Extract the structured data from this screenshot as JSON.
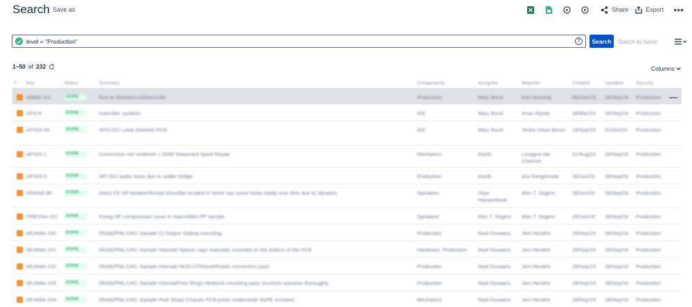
{
  "header": {
    "title": "Search",
    "save_as": "Save as",
    "share": "Share",
    "export": "Export",
    "more": "•••",
    "icons": [
      "excel-icon",
      "sheet-icon",
      "rss-icon",
      "rss-comments-icon",
      "share-icon",
      "export-icon"
    ]
  },
  "search": {
    "jql": "level = \"Production\"",
    "help": "?",
    "button": "Search",
    "switch_basic": "Switch to basic"
  },
  "results": {
    "range": "1–50",
    "of": "of",
    "total": "232",
    "columns_label": "Columns"
  },
  "colors": {
    "primary": "#0052cc",
    "success": "#36b37e",
    "issue_type": "#f79233",
    "selected_row": "#dfe1e6"
  },
  "table": {
    "headers": [
      "T",
      "Key",
      "Status",
      "Summary",
      "Components",
      "Assignee",
      "Reporter",
      "Created",
      "Updated",
      "Security"
    ],
    "rows": [
      {
        "key": "AMBA-101",
        "status": "DONE",
        "summary": "Run-in Statistics+Inline/Invite",
        "component": "Production",
        "assignee": "Mary Bond",
        "reporter": "Kim Henning",
        "created": "08/Dec/23",
        "updated": "28/Sep/24",
        "security": "Production"
      },
      {
        "key": "APS-9",
        "status": "DONE",
        "summary": "Kalender: position",
        "component": "IOC",
        "assignee": "Mary Bond",
        "reporter": "Arian Rijneb",
        "created": "28/Mar/24",
        "updated": "28/Sep/24",
        "security": "Production"
      },
      {
        "key": "APSOI-45",
        "status": "DONE",
        "summary": "APS-DCI Lokal (Market) PCB",
        "component": "IOC",
        "assignee": "Mary Bond",
        "reporter": "Torlee Ortoe Bento",
        "created": "18/Sep/24",
        "updated": "01/Oct/24",
        "security": "Production"
      },
      {
        "key": "APSOI-1",
        "status": "DONE",
        "summary": "Connection not centered + DOM Seasoned Spool Repair",
        "component": "Mechanics",
        "assignee": "Kanth",
        "reporter": "Lesagne oto Chennel",
        "created": "01/Aug/24",
        "updated": "28/Sep/24",
        "security": "Production"
      },
      {
        "key": "APSOI-5",
        "status": "DONE",
        "summary": "API DCI audio issue due to solder bridge",
        "component": "Production",
        "assignee": "Kanth",
        "reporter": "Ara Rangehoste",
        "created": "26/Jun/24",
        "updated": "28/Sep/24",
        "security": "Production"
      },
      {
        "key": "HOKKE-80",
        "status": "DONE",
        "summary": "(Hon) FS HP breaker/thread shout/ller located in home can come loose easily over time due to vibration.",
        "component": "Speakers",
        "assignee": "Skye Hansenbook",
        "reporter": "Mon T. Segers",
        "created": "28/Jun/24",
        "updated": "28/Sep/24",
        "security": "Production"
      },
      {
        "key": "PRESSA-101",
        "status": "DONE",
        "summary": "Fixing HF compression issue in macro/Mini-PP sample",
        "component": "Speakers",
        "assignee": "Mon T. Segers",
        "reporter": "Mon T. Segers",
        "created": "28/Jun/24",
        "updated": "28/Sep/24",
        "security": "Production"
      },
      {
        "key": "MUAMA-100",
        "status": "DONE",
        "summary": "(RoM)/PML/UKC Sample C) Output Setting mounting",
        "component": "Production",
        "assignee": "Noel Duvaans",
        "reporter": "Joni Hendrix",
        "created": "28/Sep/24",
        "updated": "28/Sep/24",
        "security": "Production"
      },
      {
        "key": "MUAMA-101",
        "status": "DONE",
        "summary": "(RoM)/PML/UKC Sample Internal) Spacer caps manually mounted on the bottom of the PCB",
        "component": "Hardware, Production",
        "assignee": "Noel Duvaans",
        "reporter": "Joni Hendrix",
        "created": "28/Sep/24",
        "updated": "28/Sep/24",
        "security": "Production"
      },
      {
        "key": "MUAMA-102",
        "status": "DONE",
        "summary": "(RoM)/PML/UKC Sample Internal) NCE+UTRAnet/Praxis connectors pass",
        "component": "Production",
        "assignee": "Noel Duvaans",
        "reporter": "Joni Hendrix",
        "created": "28/Sep/24",
        "updated": "28/Sep/24",
        "security": "Production"
      },
      {
        "key": "MUAMA-103",
        "status": "DONE",
        "summary": "(RoM)/PML/UKC Sample Internal/Post Shop) Heatsink mounting pass structure outcome thoroughly",
        "component": "Production",
        "assignee": "Noel Duvaans",
        "reporter": "Joni Hendrix",
        "created": "28/Sep/24",
        "updated": "28/Sep/24",
        "security": "Production"
      },
      {
        "key": "MUAMA-104",
        "status": "DONE",
        "summary": "(RoM)/PML/UKC Sample Post Shop) Chassis PCB prints underneath RoPE screwed",
        "component": "Mechanics",
        "assignee": "Noel Duvaans",
        "reporter": "Joni Hendrix",
        "created": "28/Sep/24",
        "updated": "28/Sep/24",
        "security": "Production"
      }
    ]
  }
}
